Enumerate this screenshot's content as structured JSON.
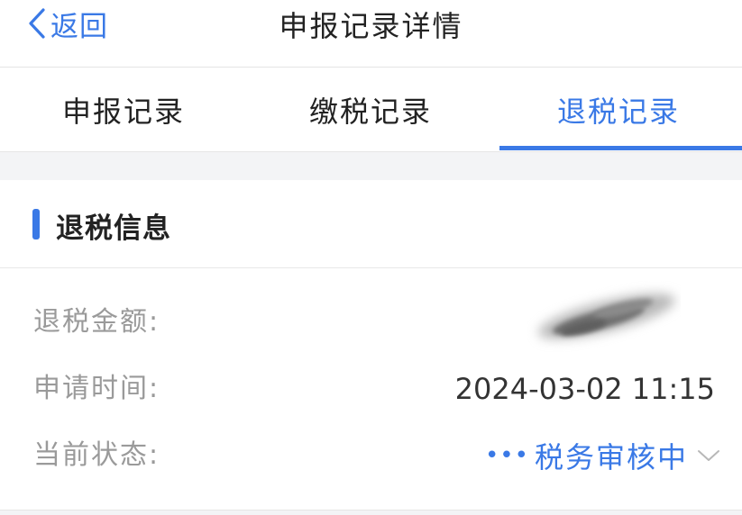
{
  "nav": {
    "back_label": "返回",
    "title": "申报记录详情"
  },
  "tabs": [
    {
      "label": "申报记录",
      "active": false
    },
    {
      "label": "缴税记录",
      "active": false
    },
    {
      "label": "退税记录",
      "active": true
    }
  ],
  "section": {
    "title": "退税信息"
  },
  "info": {
    "amount_label": "退税金额:",
    "apply_time_label": "申请时间:",
    "apply_time_value": "2024-03-02 11:15",
    "status_label": "当前状态:",
    "status_value": "税务审核中"
  },
  "colors": {
    "accent": "#3a79e6",
    "label_gray": "#9a9a9a",
    "band_gray": "#f3f4f6"
  },
  "icons": {
    "back": "chevron-left-icon",
    "status_more": "ellipsis-icon",
    "status_expand": "chevron-down-icon"
  }
}
